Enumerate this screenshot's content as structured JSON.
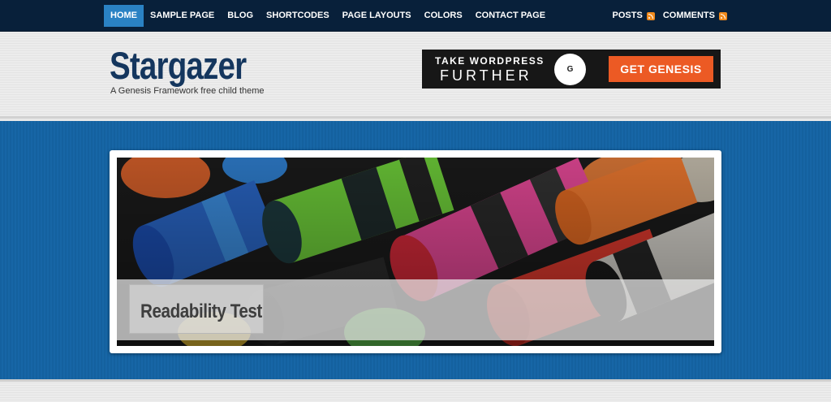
{
  "nav": {
    "items": [
      {
        "label": "HOME",
        "active": true
      },
      {
        "label": "SAMPLE PAGE",
        "active": false
      },
      {
        "label": "BLOG",
        "active": false
      },
      {
        "label": "SHORTCODES",
        "active": false
      },
      {
        "label": "PAGE LAYOUTS",
        "active": false
      },
      {
        "label": "COLORS",
        "active": false
      },
      {
        "label": "CONTACT PAGE",
        "active": false
      }
    ],
    "feeds": [
      {
        "label": "POSTS",
        "icon": "rss-icon"
      },
      {
        "label": "COMMENTS",
        "icon": "rss-icon"
      }
    ]
  },
  "header": {
    "title": "Stargazer",
    "description": "A Genesis Framework free child theme"
  },
  "banner": {
    "line1": "TAKE WORDPRESS",
    "line2": "FURTHER",
    "logo_letter": "G",
    "button": "GET GENESIS"
  },
  "featured": {
    "title": "Readability Test",
    "image": "crayons-photo"
  },
  "colors": {
    "nav_bg": "#08203a",
    "nav_active": "#2a82c4",
    "title": "#14365e",
    "blue_bg": "#1766a6",
    "banner_button": "#ec5a24",
    "rss": "#f08a1c"
  }
}
